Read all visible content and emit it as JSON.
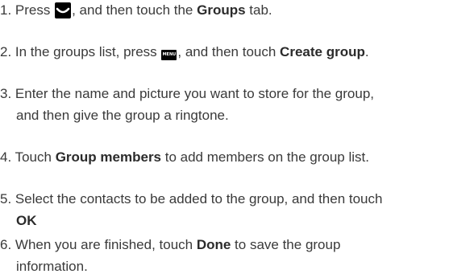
{
  "steps": [
    {
      "num": "1.",
      "t1": " Press ",
      "icon": "down-chevron-key-icon",
      "t2": ", and then touch the ",
      "b1": "Groups",
      "t3": " tab."
    },
    {
      "num": "2.",
      "t1": " In the groups list, press ",
      "icon": "menu-key-icon",
      "icon_text": "MENU",
      "t2": ", and then touch ",
      "b1": "Create group",
      "t3": "."
    },
    {
      "num": "3.",
      "t1": " Enter the name and picture you want to store for the group,",
      "t2": "and then give the group a ringtone."
    },
    {
      "num": "4.",
      "t1": " Touch ",
      "b1": "Group members",
      "t2": " to add members on the group list."
    },
    {
      "num": "5.",
      "t1": " Select the contacts to be added to the group, and then touch",
      "b1": "OK"
    },
    {
      "num": "6.",
      "t1": " When you are finished, touch ",
      "b1": "Done",
      "t2": " to save the group",
      "t3": "information."
    }
  ]
}
